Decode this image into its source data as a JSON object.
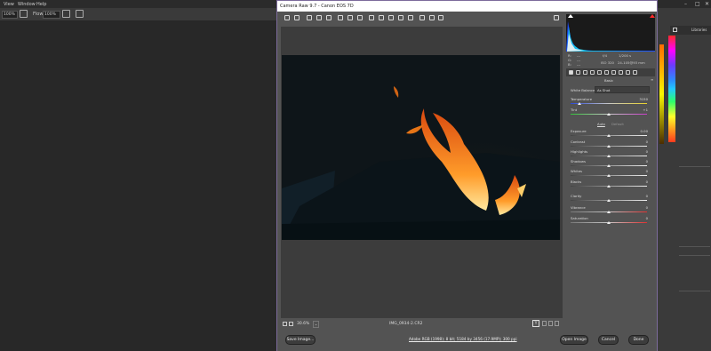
{
  "menubar": {
    "items": [
      "View",
      "Window",
      "Help"
    ]
  },
  "options_bar": {
    "zoom_value": "100%",
    "flow_label": "Flow:",
    "flow_value": "100%"
  },
  "libraries_label": "Libraries",
  "camera_raw": {
    "title": "Camera Raw 9.7  -  Canon EOS 7D",
    "preview": {
      "zoom": "30.6%",
      "filename": "IMG_0934-2.CR2"
    },
    "exif": {
      "r": "R:",
      "g": "G:",
      "b": "B:",
      "r_val": "---",
      "g_val": "---",
      "b_val": "---",
      "aperture": "f/4",
      "shutter": "1/200 s",
      "iso": "ISO 320",
      "lens": "24-105@93 mm"
    },
    "panel_title": "Basic",
    "white_balance": {
      "label": "White Balance:",
      "value": "As Shot"
    },
    "temperature": {
      "label": "Temperature",
      "value": "3150"
    },
    "tint": {
      "label": "Tint",
      "value": "+1"
    },
    "auto_label": "Auto",
    "default_label": "Default",
    "sliders": [
      {
        "label": "Exposure",
        "value": "0.00"
      },
      {
        "label": "Contrast",
        "value": "0"
      },
      {
        "label": "Highlights",
        "value": "0"
      },
      {
        "label": "Shadows",
        "value": "0"
      },
      {
        "label": "Whites",
        "value": "0"
      },
      {
        "label": "Blacks",
        "value": "0"
      },
      {
        "label": "Clarity",
        "value": "0"
      },
      {
        "label": "Vibrance",
        "value": "0"
      },
      {
        "label": "Saturation",
        "value": "0"
      }
    ],
    "buttons": {
      "save": "Save Image...",
      "open": "Open Image",
      "cancel": "Cancel",
      "done": "Done"
    },
    "workflow_link": "Adobe RGB (1998); 8 bit; 5184 by 3456 (17.9MP); 300 ppi"
  },
  "colors": {
    "accent_border": "#7c6b9b",
    "dialog_bg": "#535353"
  }
}
